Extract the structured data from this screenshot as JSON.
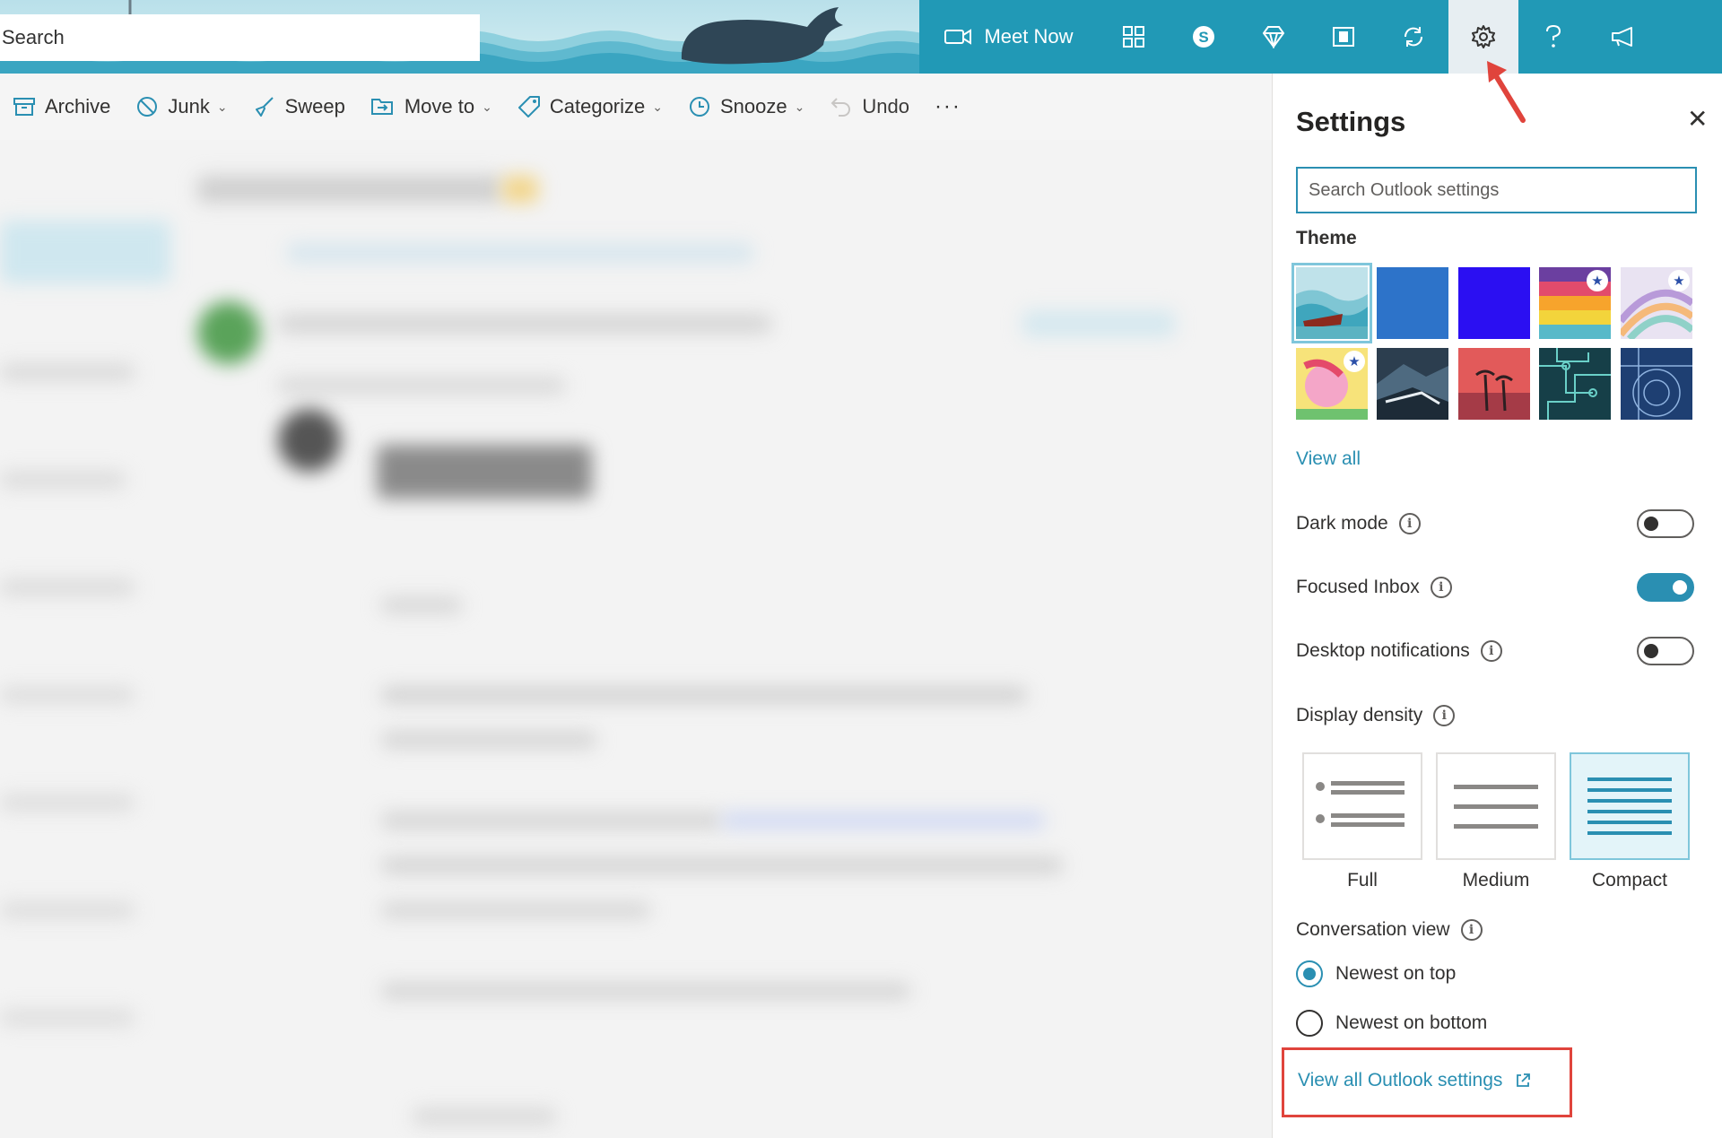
{
  "header": {
    "search_text": "Search",
    "meet_now_label": "Meet Now",
    "icons": [
      "video-camera-icon",
      "apps-grid-icon",
      "skype-icon",
      "premium-diamond-icon",
      "office-icon",
      "sync-icon",
      "gear-icon",
      "help-icon",
      "feedback-icon"
    ],
    "accent_color": "#2199b6"
  },
  "toolbar": {
    "archive": "Archive",
    "junk": "Junk",
    "sweep": "Sweep",
    "move_to": "Move to",
    "categorize": "Categorize",
    "snooze": "Snooze",
    "undo": "Undo",
    "more": "···"
  },
  "settings": {
    "title": "Settings",
    "close_glyph": "✕",
    "search_placeholder": "Search Outlook settings",
    "theme_label": "Theme",
    "themes": [
      "whale-waves",
      "blue",
      "purple-blue",
      "rainbow-stripes",
      "pastel-swirl",
      "unicorn",
      "mountains",
      "palm-sunset",
      "circuit",
      "blueprint"
    ],
    "view_all": "View all",
    "dark_mode_label": "Dark mode",
    "dark_mode_on": false,
    "focused_inbox_label": "Focused Inbox",
    "focused_inbox_on": true,
    "desktop_notifications_label": "Desktop notifications",
    "desktop_notifications_on": false,
    "display_density_label": "Display density",
    "density_options": [
      "Full",
      "Medium",
      "Compact"
    ],
    "density_selected": "Compact",
    "conversation_view_label": "Conversation view",
    "newest_on_top": "Newest on top",
    "newest_on_bottom": "Newest on bottom",
    "conversation_selected": "Newest on top",
    "view_all_settings": "View all Outlook settings",
    "link_color": "#2a8fb2",
    "highlight_color": "#e0443c"
  }
}
